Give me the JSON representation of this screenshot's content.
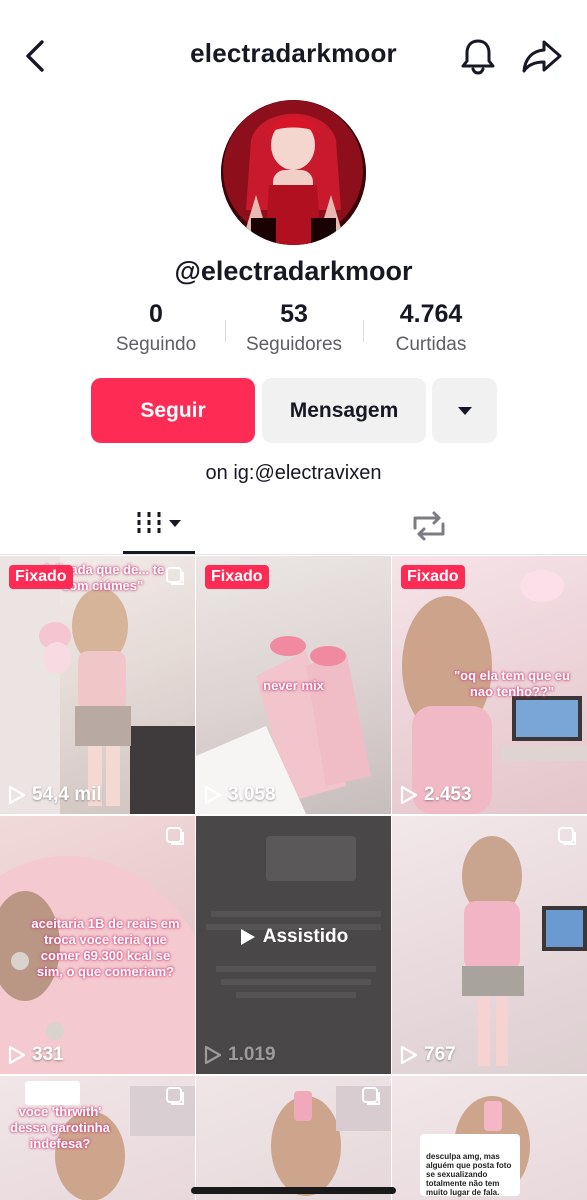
{
  "header": {
    "title": "electradarkmoor",
    "back_icon": "chevron-left-icon",
    "bell_icon": "bell-icon",
    "share_icon": "share-arrow-icon"
  },
  "profile": {
    "handle": "@electradarkmoor",
    "bio": "on ig:@electravixen"
  },
  "stats": [
    {
      "value": "0",
      "label": "Seguindo"
    },
    {
      "value": "53",
      "label": "Seguidores"
    },
    {
      "value": "4.764",
      "label": "Curtidas"
    }
  ],
  "actions": {
    "follow": "Seguir",
    "message": "Mensagem",
    "more_icon": "caret-down-icon"
  },
  "tabs": {
    "videos_icon": "grid-bars-icon",
    "reposts_icon": "repost-icon"
  },
  "colors": {
    "accent": "#fe2c55",
    "secondary_button": "#f1f1f2"
  },
  "grid": [
    {
      "pinned": "Fixado",
      "views": "54,4 mil",
      "caption": "delicada que de... te com ciúmes\""
    },
    {
      "pinned": "Fixado",
      "views": "3.058",
      "caption": "never mix"
    },
    {
      "pinned": "Fixado",
      "views": "2.453",
      "caption": "\"oq ela tem que eu nao tenho??\""
    },
    {
      "views": "331",
      "caption": "aceitaria 1B de reais em troca voce teria que comer 69.300 kcal se sim, o que comeriam?"
    },
    {
      "views": "1.019",
      "watched": "Assistido"
    },
    {
      "views": "767"
    },
    {
      "caption": "voce 'thrwith' dessa garotinha indefesa?"
    },
    {},
    {
      "caption": "desculpa amg, mas alguém que posta foto se sexualizando totalmente não tem muito lugar de fala."
    }
  ]
}
